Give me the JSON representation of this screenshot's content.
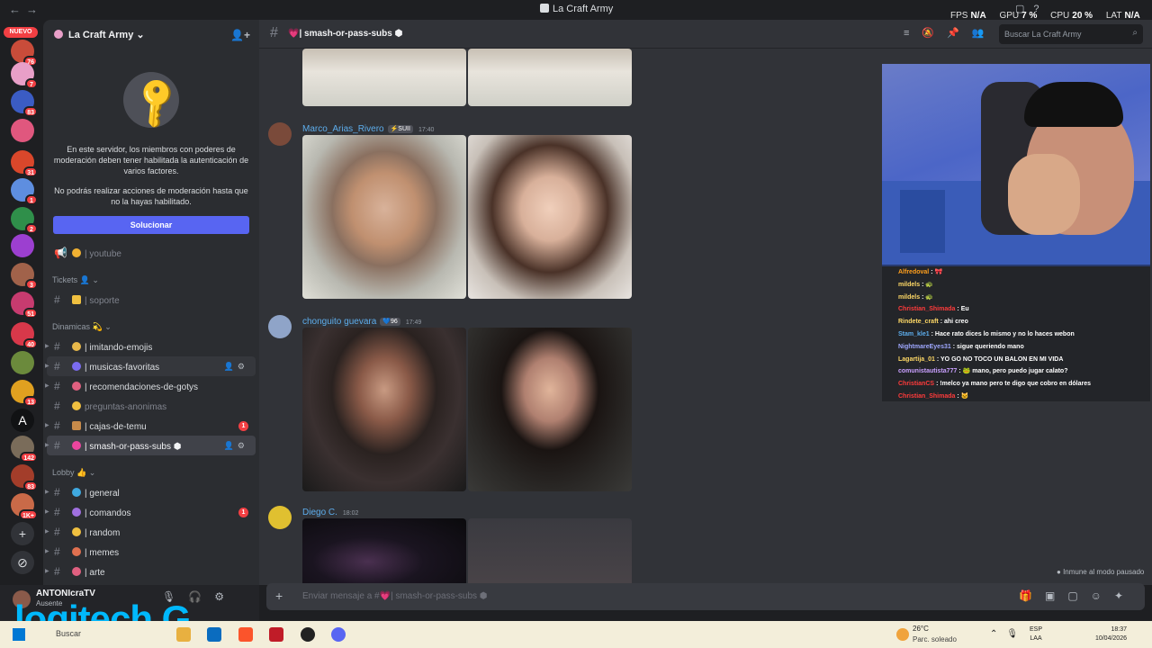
{
  "titlebar": {
    "back": "←",
    "forward": "→",
    "title": "La Craft Army"
  },
  "perf": {
    "fps_label": "FPS",
    "fps": "N/A",
    "gpu_label": "GPU",
    "gpu": "7 %",
    "cpu_label": "CPU",
    "cpu": "20 %",
    "lat_label": "LAT",
    "lat": "N/A"
  },
  "servers": {
    "nuevo": "NUEVO",
    "badges": [
      "76",
      "7",
      "83",
      "",
      "31",
      "1",
      "2",
      "",
      "3",
      "51",
      "40",
      "",
      "13",
      "",
      "142",
      "83",
      "1K+"
    ]
  },
  "server": {
    "name": "La Craft Army ⌄"
  },
  "modbox": {
    "text1": "En este servidor, los miembros con poderes de moderación deben tener habilitada la autenticación de varios factores.",
    "text2": "No podrás realizar acciones de moderación hasta que no la hayas habilitado.",
    "button": "Solucionar"
  },
  "channels": {
    "youtube": "| youtube",
    "cat_tickets": "Tickets 👤 ⌄",
    "soporte": "| soporte",
    "cat_dinamicas": "Dinamicas 💫 ⌄",
    "imitando": "| imitando-emojis",
    "musicas": "| musicas-favoritas",
    "recomendaciones": "| recomendaciones-de-gotys",
    "preguntas": "preguntas-anonimas",
    "cajas": "| cajas-de-temu",
    "cajas_badge": "1",
    "smash": "| smash-or-pass-subs ⬢",
    "cat_lobby": "Lobby 👍 ⌄",
    "general": "| general",
    "comandos": "| comandos",
    "comandos_badge": "1",
    "random": "| random",
    "memes": "| memes",
    "arte": "| arte"
  },
  "user": {
    "name": "ANTONIcraTV",
    "status": "Ausente"
  },
  "logo": "logitech G",
  "header": {
    "channel": "| smash-or-pass-subs ⬢",
    "search": "Buscar La Craft Army"
  },
  "messages": [
    {
      "author": "Marco_Arias_Rivero",
      "tag": "⚡SUII",
      "time": "17:40"
    },
    {
      "author": "chonguito guevara",
      "tag": "💙96",
      "time": "17:49"
    },
    {
      "author": "Diego C.",
      "tag": "",
      "time": "18:02"
    }
  ],
  "input": {
    "placeholder_pre": "Enviar mensaje a #",
    "placeholder_ch": "| smash-or-pass-subs ⬢"
  },
  "immune": "Inmune al modo pausado",
  "chat": [
    {
      "user": "Alfredoval",
      "color": "#ff9f1c",
      "text": ": 🎀"
    },
    {
      "user": "mildels",
      "color": "#ffd966",
      "text": ": 🐢"
    },
    {
      "user": "mildels",
      "color": "#ffd966",
      "text": ": 🐢"
    },
    {
      "user": "Christian_Shimada",
      "color": "#ff3b3b",
      "text": ": Eu"
    },
    {
      "user": "Rindete_craft",
      "color": "#ffd966",
      "text": ": ahi creo"
    },
    {
      "user": "Stam_kle1",
      "color": "#5dadec",
      "text": ": Hace rato dices lo mismo y no lo haces webon"
    },
    {
      "user": "NightmareEyes31",
      "color": "#9fa8ff",
      "text": ": sigue queriendo mano"
    },
    {
      "user": "Lagartija_01",
      "color": "#ffd966",
      "text": ": YO GO NO TOCO UN BALON EN MI VIDA"
    },
    {
      "user": "comunistautista777",
      "color": "#c9a0ff",
      "text": ": 🐸 mano, pero puedo jugar calato?"
    },
    {
      "user": "ChristianCS",
      "color": "#ff3b3b",
      "text": ": !melco ya mano pero te digo que cobro en dólares"
    },
    {
      "user": "Christian_Shimada",
      "color": "#ff3b3b",
      "text": ": 🐱"
    }
  ],
  "taskbar": {
    "search": "Buscar",
    "temp": "26°C",
    "weather": "Parc. soleado",
    "lang1": "ESP",
    "lang2": "LAA",
    "time": "18:37",
    "date": "10/04/2026"
  }
}
